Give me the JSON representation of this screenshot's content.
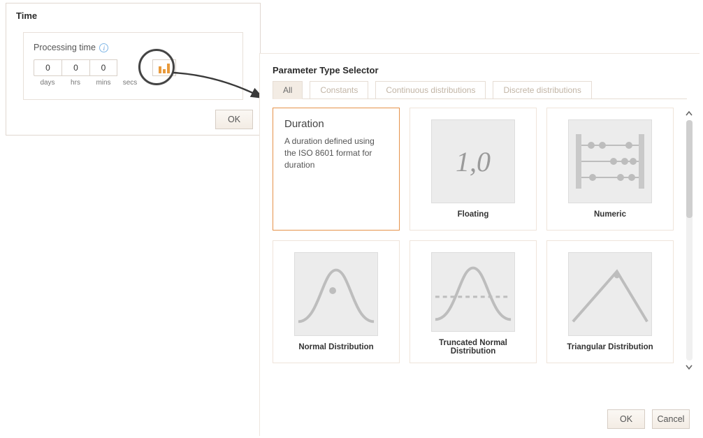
{
  "time": {
    "title": "Time",
    "processing_label": "Processing time",
    "fields": {
      "days": {
        "value": "0",
        "unit": "days"
      },
      "hrs": {
        "value": "0",
        "unit": "hrs"
      },
      "mins": {
        "value": "0",
        "unit": "mins"
      },
      "secs": {
        "unit": "secs"
      }
    },
    "ok_label": "OK"
  },
  "selector": {
    "title": "Parameter Type Selector",
    "tabs": {
      "all": "All",
      "constants": "Constants",
      "continuous": "Continuous distributions",
      "discrete": "Discrete distributions"
    },
    "cards": {
      "duration": {
        "title": "Duration",
        "desc": "A duration defined using the ISO 8601 format for duration"
      },
      "floating": {
        "caption": "Floating",
        "sample": "1,0"
      },
      "numeric": {
        "caption": "Numeric"
      },
      "normal": {
        "caption": "Normal Distribution"
      },
      "truncated": {
        "caption": "Truncated Normal Distribution"
      },
      "triangular": {
        "caption": "Triangular Distribution"
      }
    },
    "ok_label": "OK",
    "cancel_label": "Cancel"
  }
}
